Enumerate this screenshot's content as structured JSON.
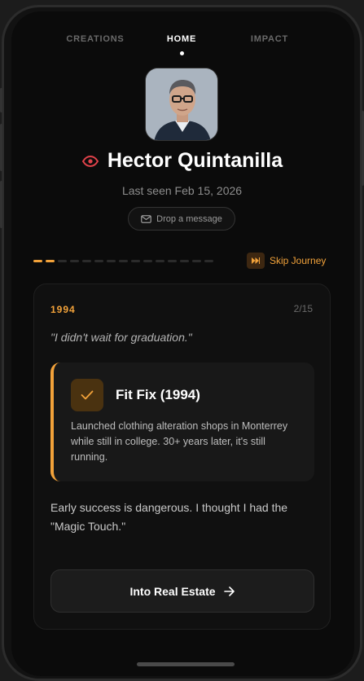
{
  "tabs": [
    {
      "label": "CREATIONS"
    },
    {
      "label": "HOME"
    },
    {
      "label": "IMPACT"
    }
  ],
  "profile": {
    "name": "Hector Quintanilla",
    "last_seen": "Last seen Feb 15, 2026",
    "message_button": "Drop a message",
    "avatar_icon": "portrait-photo"
  },
  "journey": {
    "progress_current": 2,
    "progress_total": 15,
    "skip_label": "Skip Journey"
  },
  "card": {
    "year": "1994",
    "counter": "2/15",
    "quote": "\"I didn't wait for graduation.\"",
    "highlight": {
      "title": "Fit Fix (1994)",
      "body": "Launched clothing alteration shops in Monterrey while still in college. 30+ years later, it's still running.",
      "icon": "check-icon"
    },
    "story": "Early success is dangerous. I thought I had the \"Magic Touch.\"",
    "cta_label": "Into Real Estate"
  },
  "colors": {
    "accent": "#f2a23a",
    "eye": "#e0424a",
    "background": "#0b0b0b"
  }
}
